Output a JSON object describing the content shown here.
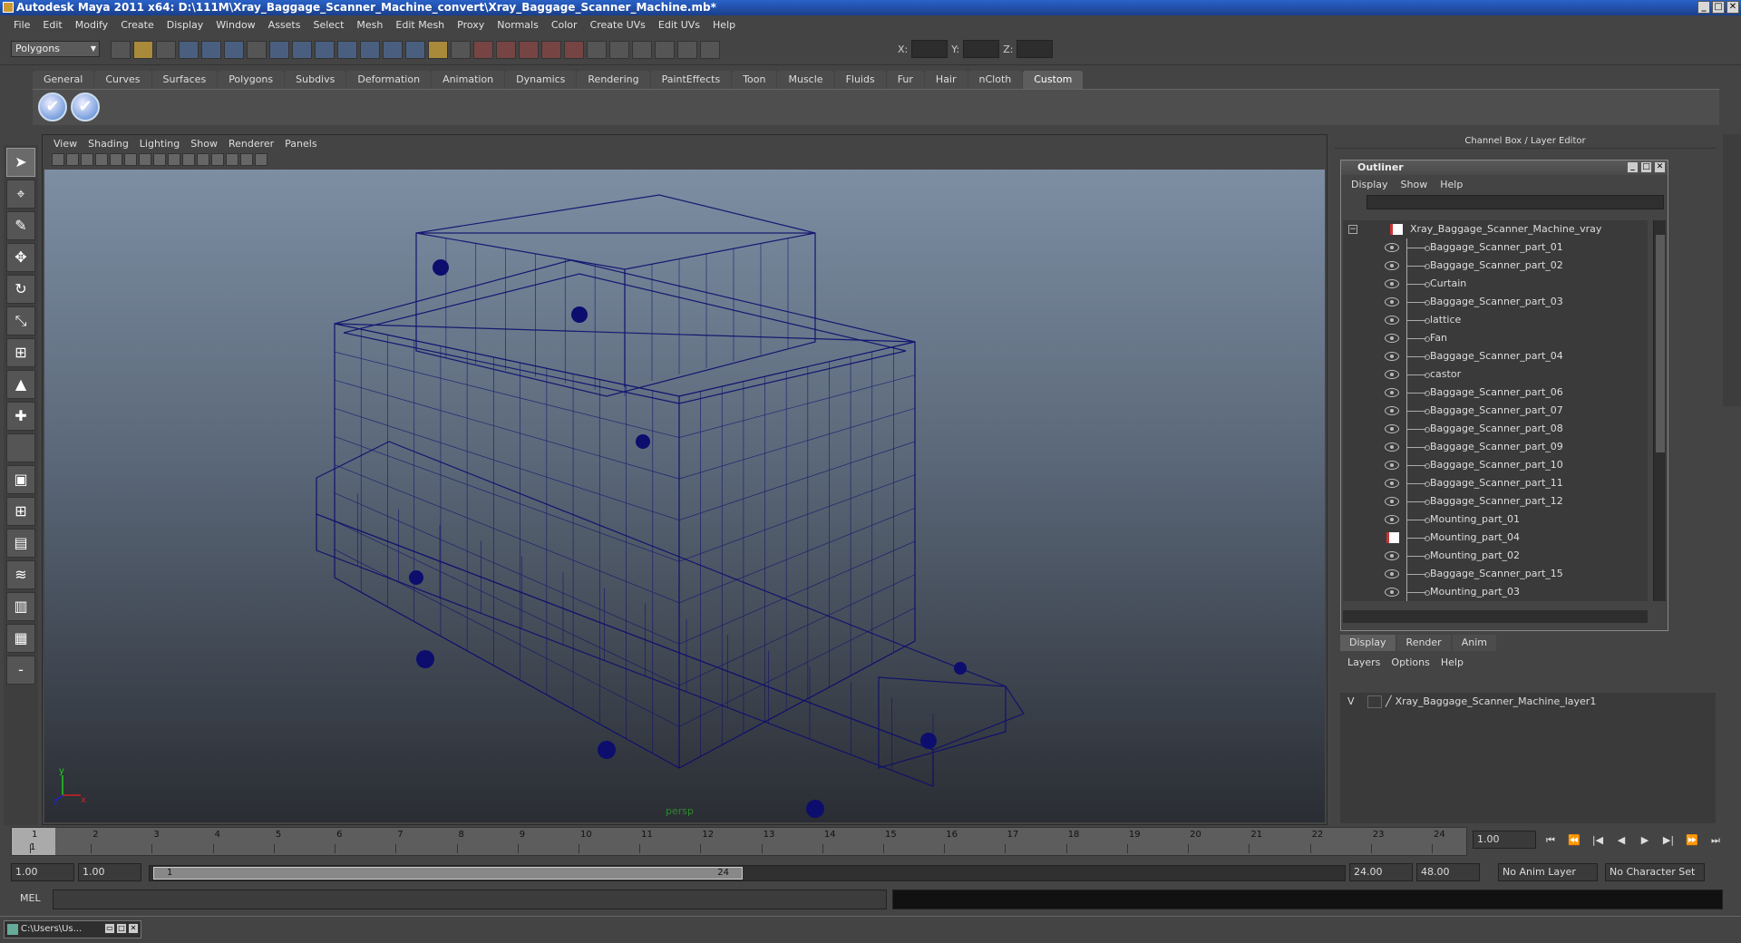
{
  "window": {
    "title": "Autodesk Maya 2011 x64: D:\\111M\\Xray_Baggage_Scanner_Machine_convert\\Xray_Baggage_Scanner_Machine.mb*"
  },
  "menu": [
    "File",
    "Edit",
    "Modify",
    "Create",
    "Display",
    "Window",
    "Assets",
    "Select",
    "Mesh",
    "Edit Mesh",
    "Proxy",
    "Normals",
    "Color",
    "Create UVs",
    "Edit UVs",
    "Help"
  ],
  "toolbar": {
    "mode": "Polygons",
    "x_label": "X:",
    "y_label": "Y:",
    "z_label": "Z:"
  },
  "shelf": {
    "tabs": [
      "General",
      "Curves",
      "Surfaces",
      "Polygons",
      "Subdivs",
      "Deformation",
      "Animation",
      "Dynamics",
      "Rendering",
      "PaintEffects",
      "Toon",
      "Muscle",
      "Fluids",
      "Fur",
      "Hair",
      "nCloth",
      "Custom"
    ],
    "active_tab": "Custom"
  },
  "viewport": {
    "menu": [
      "View",
      "Shading",
      "Lighting",
      "Show",
      "Renderer",
      "Panels"
    ],
    "camera_label": "persp",
    "axis_y": "y",
    "axis_z": "z",
    "axis_x": "x"
  },
  "sidebar": {
    "title": "Channel Box / Layer Editor"
  },
  "outliner": {
    "title": "Outliner",
    "menu": [
      "Display",
      "Show",
      "Help"
    ],
    "root": "Xray_Baggage_Scanner_Machine_vray",
    "items": [
      "Baggage_Scanner_part_01",
      "Baggage_Scanner_part_02",
      "Curtain",
      "Baggage_Scanner_part_03",
      "lattice",
      "Fan",
      "Baggage_Scanner_part_04",
      "castor",
      "Baggage_Scanner_part_06",
      "Baggage_Scanner_part_07",
      "Baggage_Scanner_part_08",
      "Baggage_Scanner_part_09",
      "Baggage_Scanner_part_10",
      "Baggage_Scanner_part_11",
      "Baggage_Scanner_part_12",
      "Mounting_part_01",
      "Mounting_part_04",
      "Mounting_part_02",
      "Baggage_Scanner_part_15",
      "Mounting_part_03"
    ]
  },
  "layers": {
    "tabs": [
      "Display",
      "Render",
      "Anim"
    ],
    "active_tab": "Display",
    "menu": [
      "Layers",
      "Options",
      "Help"
    ],
    "rows": [
      {
        "visible": "V",
        "name": "Xray_Baggage_Scanner_Machine_layer1"
      }
    ]
  },
  "timeline": {
    "ticks": [
      "1",
      "2",
      "3",
      "4",
      "5",
      "6",
      "7",
      "8",
      "9",
      "10",
      "11",
      "12",
      "13",
      "14",
      "15",
      "16",
      "17",
      "18",
      "19",
      "20",
      "21",
      "22",
      "23",
      "24"
    ],
    "current_frame": "1.00",
    "current_marker": "1"
  },
  "range": {
    "start": "1.00",
    "playback_start": "1.00",
    "slider_start": "1",
    "slider_end": "24",
    "playback_end": "24.00",
    "end": "48.00",
    "anim_layer": "No Anim Layer",
    "character_set": "No Character Set"
  },
  "command": {
    "label": "MEL"
  },
  "taskbar": {
    "item": "C:\\Users\\Us..."
  }
}
